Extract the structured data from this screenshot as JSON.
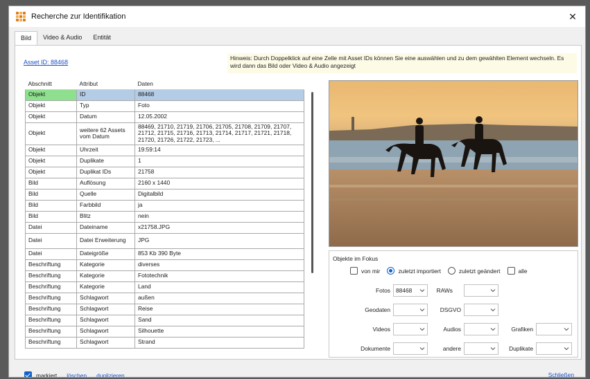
{
  "window": {
    "title": "Recherche zur Identifikation",
    "close_symbol": "✕"
  },
  "tabs": [
    {
      "label": "Bild",
      "active": true
    },
    {
      "label": "Video & Audio",
      "active": false
    },
    {
      "label": "Entität",
      "active": false
    }
  ],
  "asset_link": "Asset ID: 88468",
  "hint": "Hinweis: Durch Doppelklick auf eine Zelle mit Asset IDs können Sie eine auswählen und zu dem gewählten Element wechseln. Es wird dann das Bild oder Video & Audio angezeigt",
  "table": {
    "headers": [
      "Abschnitt",
      "Attribut",
      "Daten"
    ],
    "rows": [
      {
        "a": "Objekt",
        "b": "ID",
        "c": "88468",
        "selected": true
      },
      {
        "a": "Objekt",
        "b": "Typ",
        "c": "Foto"
      },
      {
        "a": "Objekt",
        "b": "Datum",
        "c": "12.05.2002"
      },
      {
        "a": "Objekt",
        "b": "weitere 62 Assets vom Datum",
        "c": "88469, 21710, 21719, 21706, 21705, 21708, 21709, 21707, 21712, 21715, 21716, 21713, 21714, 21717, 21721, 21718, 21720, 21726, 21722, 21723, ...",
        "tall": 3
      },
      {
        "a": "Objekt",
        "b": "Uhrzeit",
        "c": "19:59:14"
      },
      {
        "a": "Objekt",
        "b": "Duplikate",
        "c": "1"
      },
      {
        "a": "Objekt",
        "b": "Duplikat IDs",
        "c": "21758"
      },
      {
        "a": "Bild",
        "b": "Auflösung",
        "c": "2160 x 1440"
      },
      {
        "a": "Bild",
        "b": "Quelle",
        "c": "Digitalbild"
      },
      {
        "a": "Bild",
        "b": "Farbbild",
        "c": "ja"
      },
      {
        "a": "Bild",
        "b": "Blitz",
        "c": "nein"
      },
      {
        "a": "Datei",
        "b": "Dateiname",
        "c": "x21758.JPG"
      },
      {
        "a": "Datei",
        "b": "Datei Erweiterung",
        "c": "JPG",
        "tall": 2
      },
      {
        "a": "Datei",
        "b": "Dateigröße",
        "c": "853 Kb 390 Byte"
      },
      {
        "a": "Beschriftung",
        "b": "Kategorie",
        "c": "diverses"
      },
      {
        "a": "Beschriftung",
        "b": "Kategorie",
        "c": "Fototechnik"
      },
      {
        "a": "Beschriftung",
        "b": "Kategorie",
        "c": "Land"
      },
      {
        "a": "Beschriftung",
        "b": "Schlagwort",
        "c": "außen"
      },
      {
        "a": "Beschriftung",
        "b": "Schlagwort",
        "c": "Reise"
      },
      {
        "a": "Beschriftung",
        "b": "Schlagwort",
        "c": "Sand"
      },
      {
        "a": "Beschriftung",
        "b": "Schlagwort",
        "c": "Silhouette"
      },
      {
        "a": "Beschriftung",
        "b": "Schlagwort",
        "c": "Strand"
      }
    ]
  },
  "focus": {
    "title": "Objekte im Fokus",
    "options": [
      {
        "type": "checkbox",
        "label": "von mir",
        "checked": false
      },
      {
        "type": "radio",
        "label": "zuletzt importiert",
        "checked": true
      },
      {
        "type": "radio",
        "label": "zuletzt geändert",
        "checked": false
      },
      {
        "type": "checkbox",
        "label": "alle",
        "checked": false
      }
    ],
    "fotos_label": "Fotos",
    "fotos_value": "88468",
    "raws_label": "RAWs",
    "raws_value": "",
    "geodaten_label": "Geodaten",
    "geodaten_value": "",
    "dsgvo_label": "DSGVO",
    "dsgvo_value": "",
    "videos_label": "Videos",
    "videos_value": "",
    "audios_label": "Audios",
    "audios_value": "",
    "grafiken_label": "Grafiken",
    "grafiken_value": "",
    "dokumente_label": "Dokumente",
    "dokumente_value": "",
    "andere_label": "andere",
    "andere_value": "",
    "duplikate_label": "Duplikate",
    "duplikate_value": ""
  },
  "footer": {
    "markiert_label": "markiert",
    "markiert_checked": true,
    "loeschen_label": "löschen",
    "duplizieren_label": "duplizieren",
    "schliessen_label": "Schließen"
  }
}
